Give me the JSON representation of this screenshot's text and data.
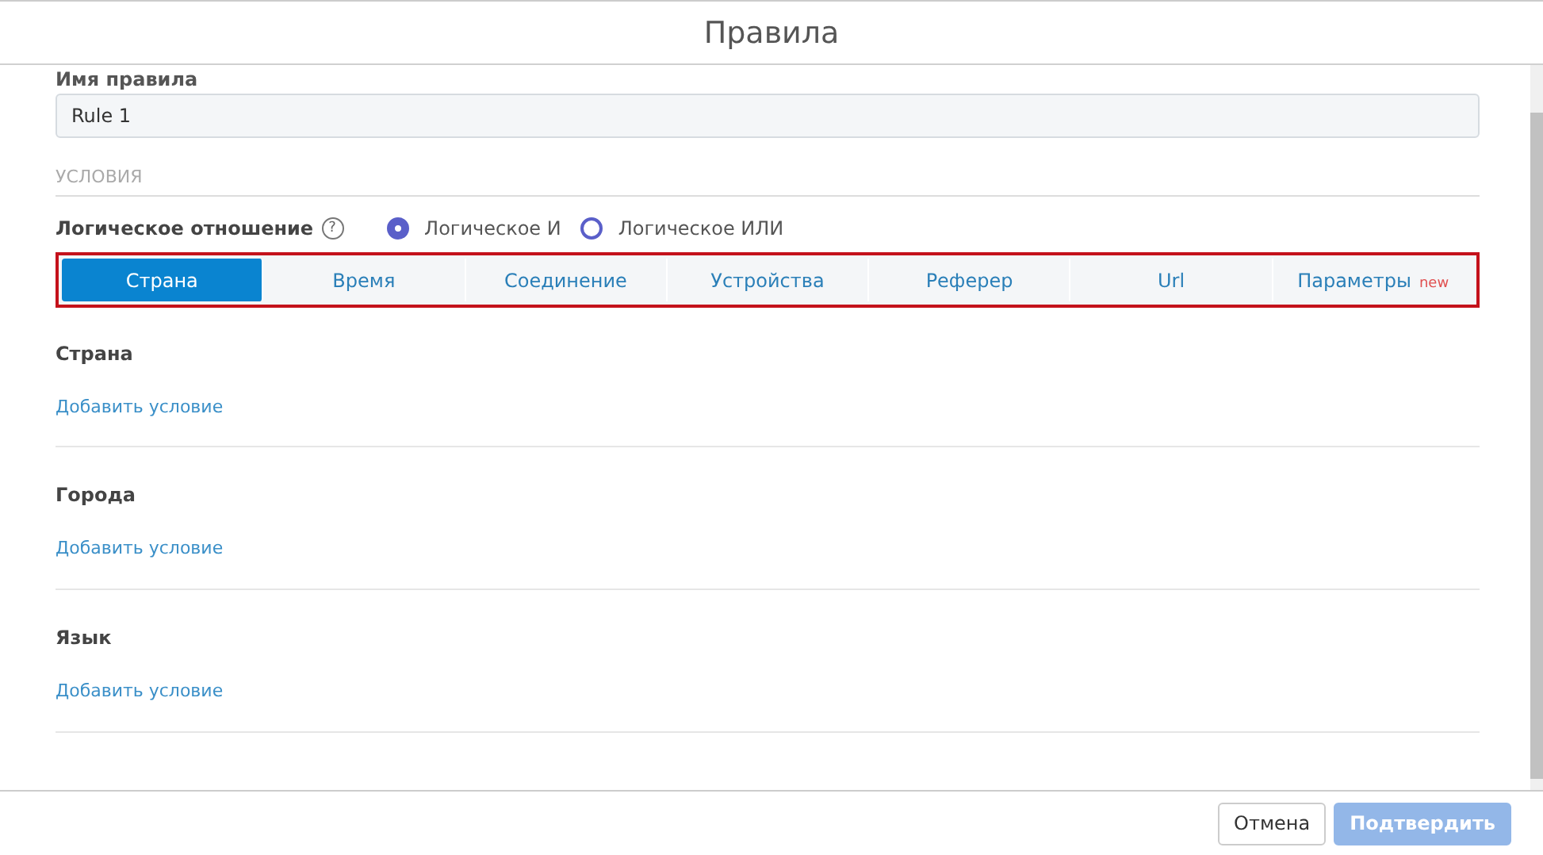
{
  "dialog": {
    "title": "Правила"
  },
  "rule_name": {
    "label": "Имя правила",
    "value": "Rule 1"
  },
  "conditions_heading": "УСЛОВИЯ",
  "logic": {
    "label": "Логическое отношение",
    "help": "?",
    "options": [
      {
        "label": "Логическое И",
        "selected": true
      },
      {
        "label": "Логическое ИЛИ",
        "selected": false
      }
    ]
  },
  "tabs": [
    {
      "label": "Страна",
      "selected": true
    },
    {
      "label": "Время",
      "selected": false
    },
    {
      "label": "Соединение",
      "selected": false
    },
    {
      "label": "Устройства",
      "selected": false
    },
    {
      "label": "Реферер",
      "selected": false
    },
    {
      "label": "Url",
      "selected": false
    },
    {
      "label": "Параметры",
      "badge": "new",
      "selected": false
    }
  ],
  "sections": [
    {
      "title": "Страна",
      "link": "Добавить условие"
    },
    {
      "title": "Города",
      "link": "Добавить условие"
    },
    {
      "title": "Язык",
      "link": "Добавить условие"
    }
  ],
  "buttons": [
    {
      "label": "Отмена",
      "kind": "secondary"
    },
    {
      "label": "Подтвердить",
      "kind": "primary",
      "disabled": true
    }
  ]
}
